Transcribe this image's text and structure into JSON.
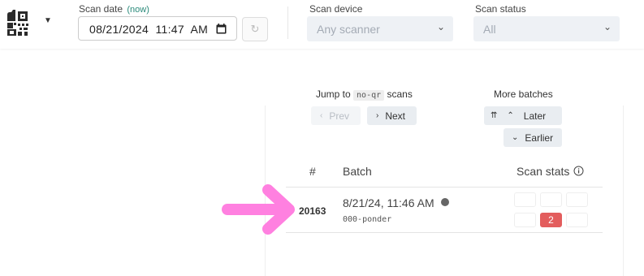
{
  "toolbar": {
    "scan_date_label": "Scan date",
    "scan_date_now": "(now)",
    "scan_date_value": "08/21/2024  11:47  AM",
    "scan_device_label": "Scan device",
    "scan_device_value": "Any scanner",
    "scan_status_label": "Scan status",
    "scan_status_value": "All"
  },
  "nav": {
    "jump_prefix": "Jump to",
    "jump_code": "no-qr",
    "jump_suffix": "scans",
    "prev_label": "Prev",
    "next_label": "Next",
    "more_batches_label": "More batches",
    "later_label": "Later",
    "earlier_label": "Earlier"
  },
  "table": {
    "headers": [
      "#",
      "Batch",
      "Scan stats"
    ],
    "rows": [
      {
        "id": "20163",
        "time": "8/21/24, 11:46 AM",
        "name": "000-ponder",
        "error_count": "2"
      }
    ]
  },
  "colors": {
    "error_badge": "#e35d5d",
    "annotation_arrow": "#ff80e0",
    "now_text": "#2a8a7a"
  }
}
